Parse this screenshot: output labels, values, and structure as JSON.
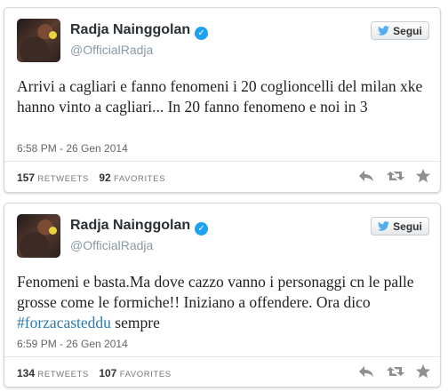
{
  "tweets": [
    {
      "name": "Radja Nainggolan",
      "handle": "@OfficialRadja",
      "follow_label": "Segui",
      "text": "Arrivi a cagliari e fanno fenomeni i 20 coglioncelli del milan xke hanno vinto a cagliari... In 20 fanno fenomeno e noi in 3",
      "timestamp": "6:58 PM - 26 Gen 2014",
      "retweets": "157",
      "retweets_label": "RETWEETS",
      "favorites": "92",
      "favorites_label": "FAVORITES"
    },
    {
      "name": "Radja Nainggolan",
      "handle": "@OfficialRadja",
      "follow_label": "Segui",
      "text_before": "Fenomeni e basta.Ma dove cazzo vanno i personaggi cn le palle grosse come le formiche!! Iniziano a offendere. Ora dico ",
      "hashtag": "#forzacasteddu",
      "text_after": " sempre",
      "timestamp": "6:59 PM - 26 Gen 2014",
      "retweets": "134",
      "retweets_label": "RETWEETS",
      "favorites": "107",
      "favorites_label": "FAVORITES"
    }
  ],
  "icons": {
    "verified": "verified-check-icon",
    "follow": "twitter-bird-icon",
    "reply": "reply-arrow-icon",
    "retweet": "retweet-icon",
    "favorite": "star-icon"
  },
  "colors": {
    "hashtag": "#2a7ab0",
    "verified": "#1da1f2",
    "twitter_bird": "#55acee"
  }
}
